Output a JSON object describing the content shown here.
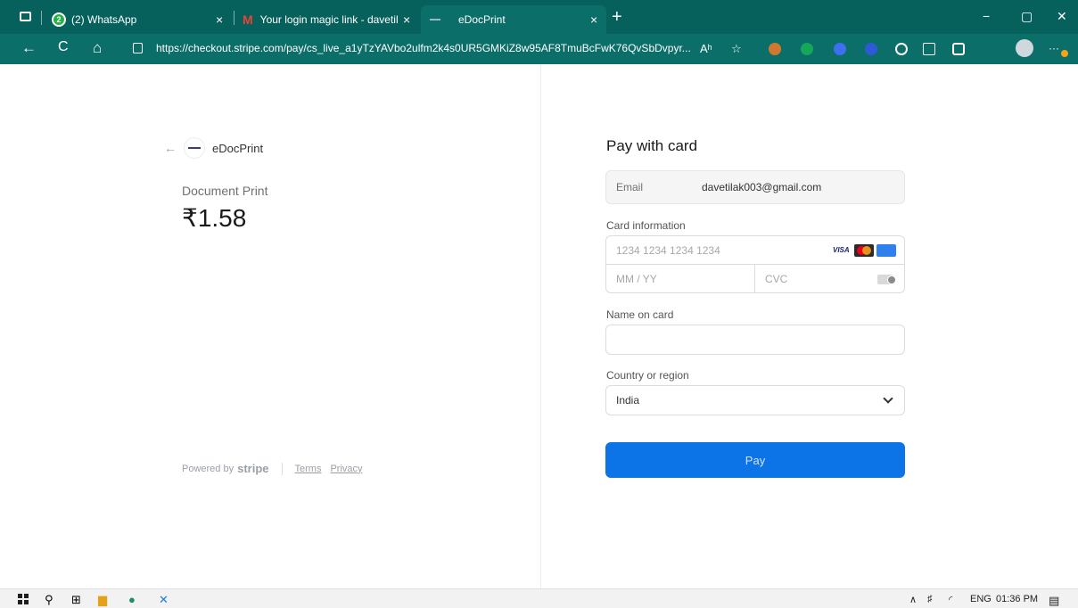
{
  "browser": {
    "tabs": [
      {
        "label": "(2) WhatsApp",
        "badge": "2"
      },
      {
        "label": "Your login magic link - davetilak",
        "icon": "M"
      },
      {
        "label": "eDocPrint"
      }
    ],
    "new_tab": "+",
    "close": "×",
    "window_controls": {
      "minimize": "−",
      "restore": "▢",
      "close": "✕"
    },
    "url": "https://checkout.stripe.com/pay/cs_live_a1yTzYAVbo2ulfm2k4s0UR5GMKiZ8w95AF8TmuBcFwK76QvSbDvpyr...",
    "nav": {
      "back": "←",
      "reload": "C",
      "home": "⌂"
    },
    "tools": {
      "read_aloud": "Aʰ",
      "favorite": "☆"
    }
  },
  "merchant": {
    "name": "eDocPrint",
    "back": "←"
  },
  "product": {
    "name": "Document Print",
    "price": "₹1.58"
  },
  "footer": {
    "powered_by": "Powered by",
    "brand": "stripe",
    "terms": "Terms",
    "privacy": "Privacy"
  },
  "form": {
    "title": "Pay with card",
    "email_label": "Email",
    "email_value": "davetilak003@gmail.com",
    "card_label": "Card information",
    "card_placeholder": "1234 1234 1234 1234",
    "card_brands": [
      "VISA",
      "Mastercard",
      "Amex"
    ],
    "exp_placeholder": "MM / YY",
    "cvc_placeholder": "CVC",
    "name_label": "Name on card",
    "name_value": "",
    "country_label": "Country or region",
    "country_value": "India",
    "pay_button": "Pay"
  },
  "taskbar": {
    "language": "ENG",
    "time": "01:36 PM",
    "up_arrow": "∧"
  },
  "colors": {
    "tab_bar": "#06615c",
    "address_bar": "#0b6e68",
    "pay_button": "#0d74e7"
  }
}
